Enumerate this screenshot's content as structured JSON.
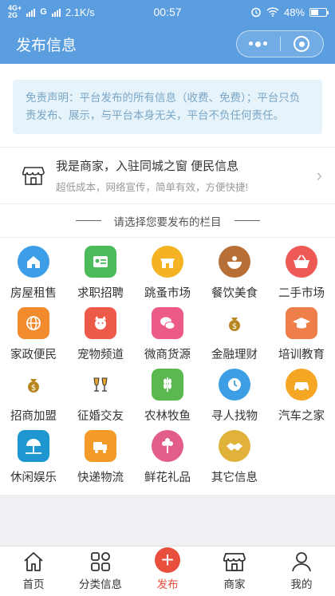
{
  "status": {
    "network": "4G+",
    "network2": "2G",
    "carrier": "G",
    "speed": "2.1K/s",
    "time": "00:57",
    "battery": "48%",
    "battery_level": 0.48
  },
  "nav": {
    "title": "发布信息"
  },
  "notice": "免责声明：平台发布的所有信息（收费、免费）；平台只负责发布、展示，与平台本身无关，平台不负任何责任。",
  "merchant": {
    "title": "我是商家，入驻同城之窗 便民信息",
    "subtitle": "超低成本，网络宣传，简单有效，方便快捷!"
  },
  "select_prompt": "请选择您要发布的栏目",
  "categories": [
    {
      "label": "房屋租售",
      "icon": "house-icon",
      "color": "#3b9ee6"
    },
    {
      "label": "求职招聘",
      "icon": "id-card-icon",
      "color": "#4cbc5a"
    },
    {
      "label": "跳蚤市场",
      "icon": "market-stall-icon",
      "color": "#f5b323"
    },
    {
      "label": "餐饮美食",
      "icon": "food-bowl-icon",
      "color": "#b86f35"
    },
    {
      "label": "二手市场",
      "icon": "basket-icon",
      "color": "#ef5a57"
    },
    {
      "label": "家政便民",
      "icon": "globe-icon",
      "color": "#f28a2e"
    },
    {
      "label": "宠物频道",
      "icon": "pet-icon",
      "color": "#ee5a49"
    },
    {
      "label": "微商货源",
      "icon": "chat-icon",
      "color": "#ec5b87"
    },
    {
      "label": "金融理财",
      "icon": "money-bag-icon",
      "color": "#e7a52f"
    },
    {
      "label": "培训教育",
      "icon": "graduation-cap-icon",
      "color": "#ee7f4a"
    },
    {
      "label": "招商加盟",
      "icon": "dollar-bag-icon",
      "color": "#e7a52f"
    },
    {
      "label": "征婚交友",
      "icon": "cheers-icon",
      "color": "#e7a52f"
    },
    {
      "label": "农林牧鱼",
      "icon": "wheat-icon",
      "color": "#5ab84f"
    },
    {
      "label": "寻人找物",
      "icon": "clock-icon",
      "color": "#3d9ee3"
    },
    {
      "label": "汽车之家",
      "icon": "car-icon",
      "color": "#f5a623"
    },
    {
      "label": "休闲娱乐",
      "icon": "beach-umbrella-icon",
      "color": "#1e96cf"
    },
    {
      "label": "快递物流",
      "icon": "delivery-icon",
      "color": "#f49a29"
    },
    {
      "label": "鲜花礼品",
      "icon": "flower-icon",
      "color": "#e35d8a"
    },
    {
      "label": "其它信息",
      "icon": "handshake-icon",
      "color": "#e0b23a"
    }
  ],
  "tabs": [
    {
      "label": "首页",
      "icon": "home-icon"
    },
    {
      "label": "分类信息",
      "icon": "grid-icon"
    },
    {
      "label": "发布",
      "icon": "plus-icon"
    },
    {
      "label": "商家",
      "icon": "shop-icon"
    },
    {
      "label": "我的",
      "icon": "user-icon"
    }
  ]
}
